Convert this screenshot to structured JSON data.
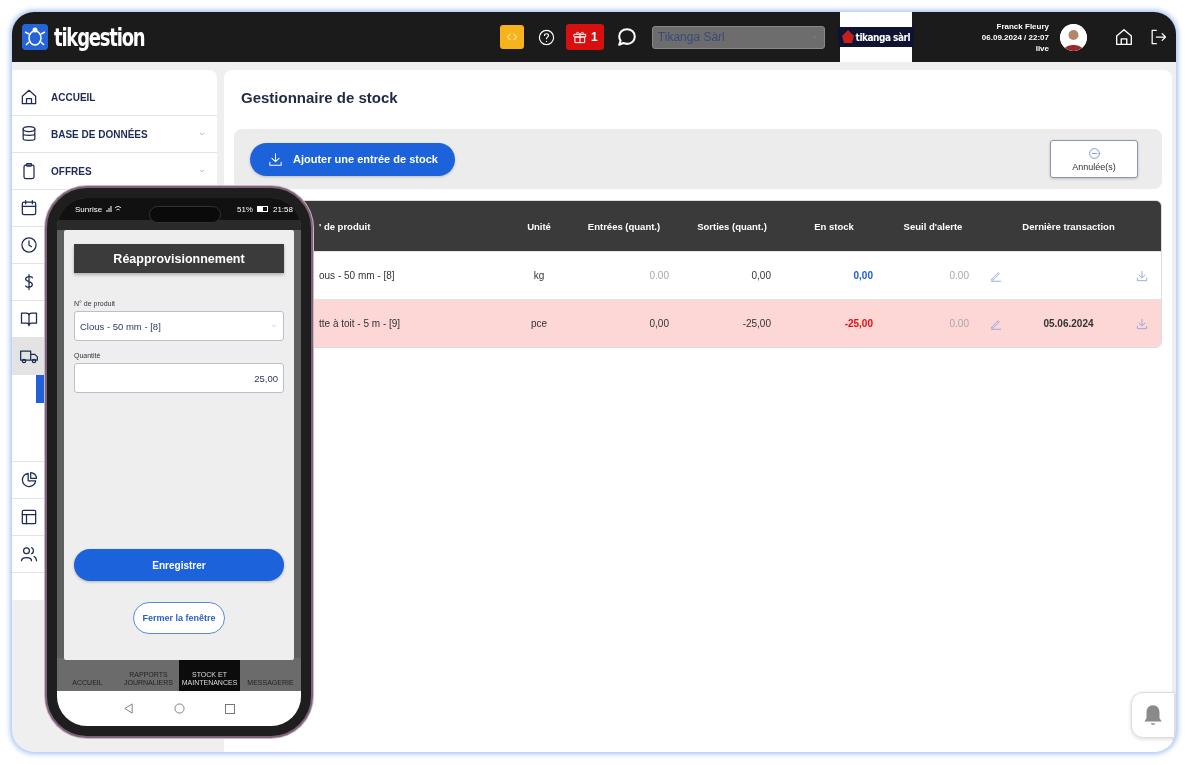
{
  "header": {
    "app_name": "tikgestion",
    "gift_count": "1",
    "company_select": {
      "value": "Tikanga Sàrl",
      "disabled": true
    },
    "company_logo": "tikanga sàrl",
    "user": {
      "name": "Franck Fleury",
      "datetime": "06.09.2024 / 22:07",
      "mode": "live"
    }
  },
  "sidebar": {
    "items": [
      {
        "label": "ACCUEIL",
        "selected": false
      },
      {
        "label": "BASE DE DONNÉES",
        "selected": false,
        "expanded": false
      },
      {
        "label": "OFFRES",
        "selected": false,
        "expanded": false
      },
      {
        "selected": false
      },
      {
        "selected": false
      },
      {
        "selected": false
      },
      {
        "selected": false
      },
      {
        "selected": true,
        "expanded": true
      },
      {
        "selected": false
      },
      {
        "selected": false
      },
      {
        "selected": false
      }
    ]
  },
  "page": {
    "title": "Gestionnaire de stock",
    "add_button": "Ajouter une entrée de stock",
    "cancelled_button": "Annulée(s)",
    "table": {
      "columns": [
        "' de produit",
        "Unité",
        "Entrées (quant.)",
        "Sorties (quant.)",
        "En stock",
        "Seuil d'alerte",
        "Dernière transaction"
      ],
      "rows": [
        {
          "product": "ous - 50 mm - [8]",
          "unit": "kg",
          "entries": "0.00",
          "entries_dim": true,
          "exits": "0,00",
          "stock": "0,00",
          "threshold": "0.00",
          "alert": false
        },
        {
          "product": "tte à toit - 5 m - [9]",
          "unit": "pce",
          "entries": "0,00",
          "entries_dim": false,
          "exits": "-25,00",
          "stock": "-25,00",
          "threshold": "0.00",
          "last_transaction": "05.06.2024",
          "alert": true
        }
      ]
    }
  },
  "phone": {
    "status_bar": {
      "carrier": "Sunrise",
      "battery": "51%",
      "time": "21:58"
    },
    "modal": {
      "title": "Réapprovisionnement",
      "product_label": "N° de produit",
      "product_value": "Clous - 50 mm - [8]",
      "quantity_label": "Quantité",
      "quantity_value": "25,00",
      "save_button": "Enregistrer",
      "close_button": "Fermer la fenêtre"
    },
    "bottom_nav": [
      {
        "label": "ACCUEIL",
        "selected": false
      },
      {
        "label": "RAPPORTS JOURNALIERS",
        "selected": false
      },
      {
        "label": "STOCK ET MAINTENANCES",
        "selected": true
      },
      {
        "label": "MESSAGERIE",
        "selected": false
      }
    ]
  }
}
